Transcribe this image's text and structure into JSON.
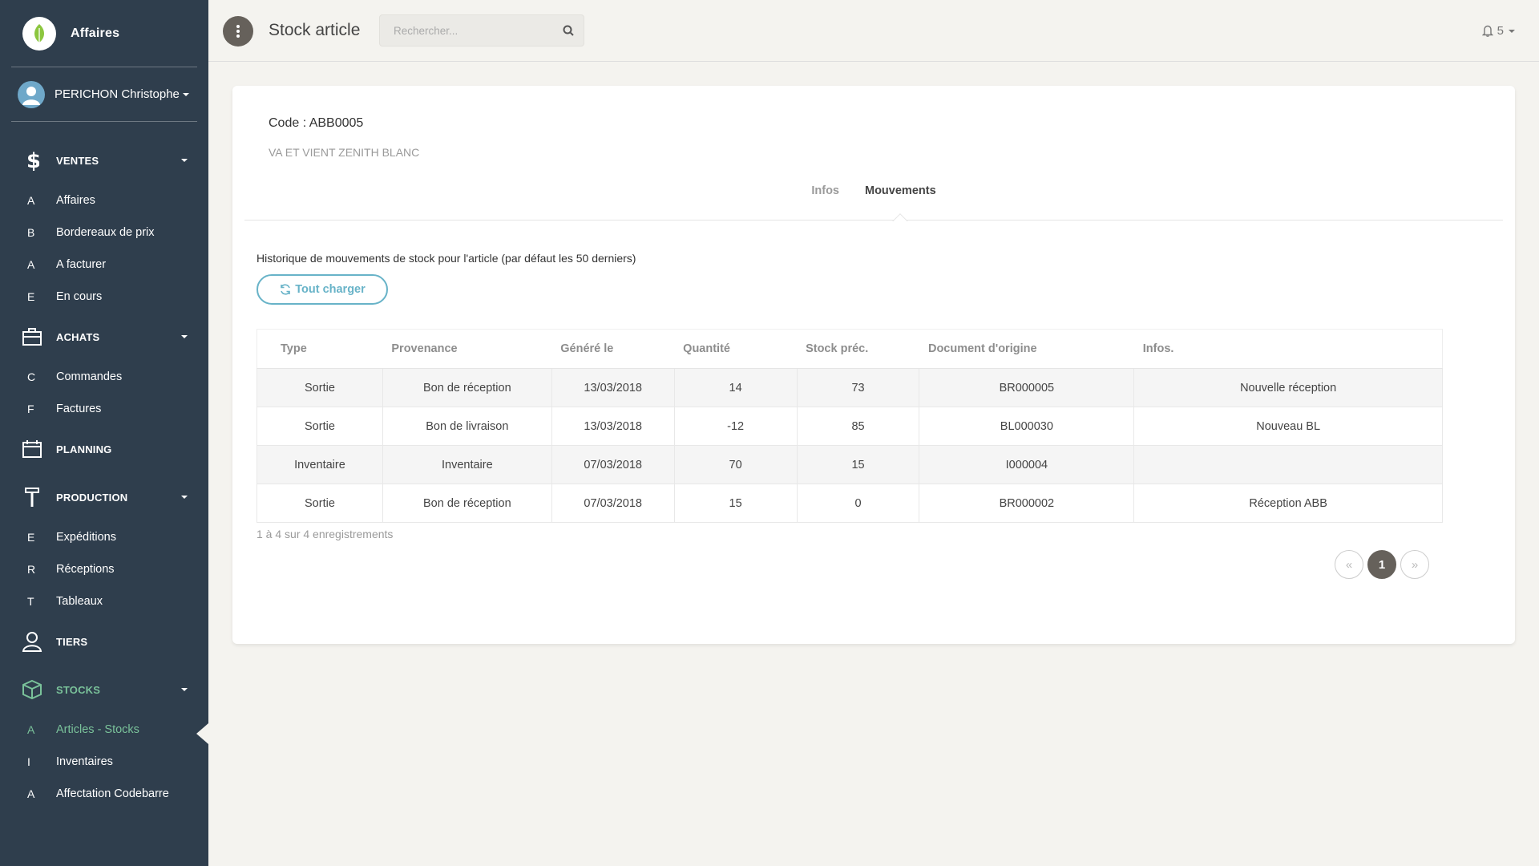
{
  "app": {
    "name": "Affaires",
    "brand_color": "#7ac29a",
    "sidebar_color": "#2f3e4d",
    "info_color": "#68b3c8"
  },
  "user": {
    "name": "PERICHON Christophe"
  },
  "sidebar": {
    "sections": [
      {
        "label": "VENTES",
        "icon": "dollar-icon",
        "items": [
          {
            "abbr": "A",
            "label": "Affaires"
          },
          {
            "abbr": "B",
            "label": "Bordereaux de prix"
          },
          {
            "abbr": "A",
            "label": "A facturer"
          },
          {
            "abbr": "E",
            "label": "En cours"
          }
        ]
      },
      {
        "label": "ACHATS",
        "icon": "briefcase-icon",
        "items": [
          {
            "abbr": "C",
            "label": "Commandes"
          },
          {
            "abbr": "F",
            "label": "Factures"
          }
        ]
      },
      {
        "label": "PLANNING",
        "icon": "calendar-icon",
        "items": []
      },
      {
        "label": "PRODUCTION",
        "icon": "hammer-icon",
        "items": [
          {
            "abbr": "E",
            "label": "Expéditions"
          },
          {
            "abbr": "R",
            "label": "Réceptions"
          },
          {
            "abbr": "T",
            "label": "Tableaux"
          }
        ]
      },
      {
        "label": "TIERS",
        "icon": "user-icon",
        "items": []
      },
      {
        "label": "STOCKS",
        "icon": "box-icon",
        "items": [
          {
            "abbr": "A",
            "label": "Articles - Stocks"
          },
          {
            "abbr": "I",
            "label": "Inventaires"
          },
          {
            "abbr": "A",
            "label": "Affectation Codebarre"
          }
        ]
      }
    ]
  },
  "topbar": {
    "title": "Stock article",
    "search_placeholder": "Rechercher...",
    "notifications": "5"
  },
  "article": {
    "code": "Code : ABB0005",
    "description": "VA ET VIENT ZENITH BLANC"
  },
  "tabs": [
    {
      "label": "Infos"
    },
    {
      "label": "Mouvements"
    }
  ],
  "movements": {
    "intro": "Historique de mouvements de stock pour l'article (par défaut les 50 derniers)",
    "load_all": "Tout charger",
    "columns": [
      "Type",
      "Provenance",
      "Généré le",
      "Quantité",
      "Stock préc.",
      "Document d'origine",
      "Infos."
    ],
    "rows": [
      [
        "Sortie",
        "Bon de réception",
        "13/03/2018",
        "14",
        "73",
        "BR000005",
        "Nouvelle réception"
      ],
      [
        "Sortie",
        "Bon de livraison",
        "13/03/2018",
        "-12",
        "85",
        "BL000030",
        "Nouveau BL"
      ],
      [
        "Inventaire",
        "Inventaire",
        "07/03/2018",
        "70",
        "15",
        "I000004",
        ""
      ],
      [
        "Sortie",
        "Bon de réception",
        "07/03/2018",
        "15",
        "0",
        "BR000002",
        "Réception ABB"
      ]
    ],
    "count_text": "1 à 4 sur 4 enregistrements"
  },
  "pagination": {
    "prev": "«",
    "current": "1",
    "next": "»"
  }
}
